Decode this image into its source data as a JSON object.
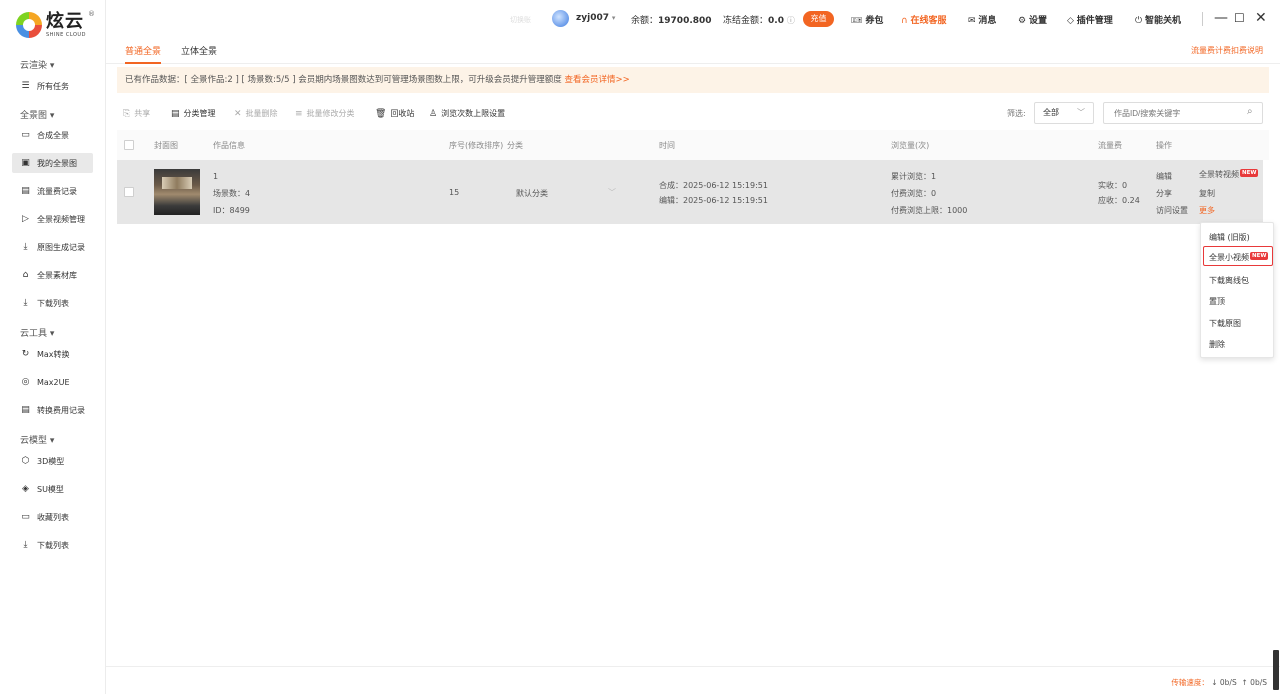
{
  "logo": {
    "cn": "炫云",
    "en": "SHINE CLOUD",
    "reg": "®"
  },
  "sidebar": {
    "groups": [
      {
        "label": "云渲染 ▾"
      },
      {
        "label": "全景图 ▾"
      },
      {
        "label": "云工具 ▾"
      },
      {
        "label": "云模型 ▾"
      }
    ],
    "items": [
      {
        "label": "所有任务",
        "icon": "list-icon"
      },
      {
        "label": "合成全景",
        "icon": "panorama-icon"
      },
      {
        "label": "我的全景图",
        "icon": "image-icon"
      },
      {
        "label": "流量费记录",
        "icon": "record-icon"
      },
      {
        "label": "全景视频管理",
        "icon": "video-icon"
      },
      {
        "label": "原图生成记录",
        "icon": "download-icon"
      },
      {
        "label": "全景素材库",
        "icon": "library-icon"
      },
      {
        "label": "下载列表",
        "icon": "download-icon"
      },
      {
        "label": "Max转换",
        "icon": "convert-icon"
      },
      {
        "label": "Max2UE",
        "icon": "max2ue-icon"
      },
      {
        "label": "转换费用记录",
        "icon": "doc-icon"
      },
      {
        "label": "3D模型",
        "icon": "cube-icon"
      },
      {
        "label": "SU模型",
        "icon": "su-icon"
      },
      {
        "label": "收藏列表",
        "icon": "box-icon"
      },
      {
        "label": "下载列表",
        "icon": "download-icon"
      }
    ]
  },
  "topbar": {
    "faint_label": "切换账",
    "username": "zyj007",
    "balance_label": "余额：",
    "balance": "19700.800",
    "frozen_label": "冻结金额：",
    "frozen": "0.0",
    "recharge": "充值",
    "coupon": "券包",
    "support": "在线客服",
    "messages": "消息",
    "settings": "设置",
    "plugins": "插件管理",
    "shutdown": "智能关机"
  },
  "tabs": {
    "items": [
      "普通全景",
      "立体全景"
    ],
    "active": "普通全景",
    "fee_note": "流量费计费扣费说明"
  },
  "banner": {
    "text": "已有作品数据：[ 全景作品:2 ] [ 场景数:5/5 ] 会员期内场景图数达到可管理场景图数上限，可升级会员提升管理额度",
    "link": "查看会员详情>>"
  },
  "toolbar": {
    "share": "共享",
    "category": "分类管理",
    "batch_delete": "批量删除",
    "batch_category": "批量修改分类",
    "recycle": "回收站",
    "view_limit": "浏览次数上限设置",
    "filter_label": "筛选:",
    "filter_value": "全部",
    "search_placeholder": "作品ID/搜索关键字"
  },
  "table": {
    "headers": {
      "cover": "封面图",
      "info": "作品信息",
      "order": "序号(修改排序)",
      "category": "分类",
      "time": "时间",
      "views": "浏览量(次)",
      "traffic": "流量费",
      "ops": "操作"
    },
    "rows": [
      {
        "name": "1",
        "scenes": "场景数：4",
        "id": "ID：8499",
        "order": "15",
        "category": "默认分类",
        "composed": "合成：2025-06-12 15:19:51",
        "edited": "编辑：2025-06-12 15:19:51",
        "views_total": "累计浏览：1",
        "views_paid": "付费浏览：0",
        "views_limit": "付费浏览上限：1000",
        "paid_actual": "实收：0",
        "paid_due": "应收：0.24",
        "ops": {
          "edit": "编辑",
          "to_video": "全景转视频",
          "share": "分享",
          "copy": "复制",
          "access": "访问设置",
          "more": "更多"
        }
      }
    ]
  },
  "badge_new": "NEW",
  "dropdown": {
    "items": [
      "编辑 (旧版)",
      "全景小视频",
      "下载离线包",
      "置顶",
      "下载原图",
      "删除"
    ]
  },
  "status": {
    "speed_label": "传输速度：",
    "down": "↓ 0b/S",
    "up": "↑ 0b/S"
  },
  "colors": {
    "accent": "#f26522",
    "badge": "#e8393a",
    "row_bg": "#e6e6e6"
  }
}
